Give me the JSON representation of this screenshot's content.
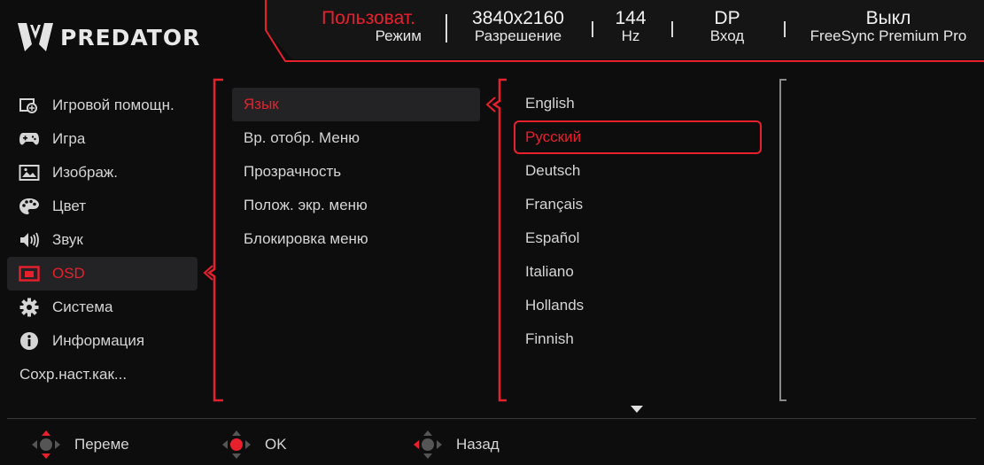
{
  "brand": {
    "logo_text": "PREDATOR"
  },
  "header": {
    "mode": {
      "value": "Пользоват.",
      "label": "Режим"
    },
    "resolution": {
      "value": "3840x2160",
      "label": "Разрешение"
    },
    "refresh": {
      "value": "144",
      "label": "Hz"
    },
    "input": {
      "value": "DP",
      "label": "Вход"
    },
    "freesync": {
      "value": "Выкл",
      "label": "FreeSync Premium Pro"
    }
  },
  "main_menu": {
    "selected": "OSD",
    "items": [
      {
        "label": "Игровой помощн.",
        "icon": "game-assist-icon"
      },
      {
        "label": "Игра",
        "icon": "gamepad-icon"
      },
      {
        "label": "Изображ.",
        "icon": "picture-icon"
      },
      {
        "label": "Цвет",
        "icon": "palette-icon"
      },
      {
        "label": "Звук",
        "icon": "speaker-icon"
      },
      {
        "label": "OSD",
        "icon": "osd-icon"
      },
      {
        "label": "Система",
        "icon": "gear-icon"
      },
      {
        "label": "Информация",
        "icon": "info-icon"
      },
      {
        "label": "Сохр.наст.как..."
      }
    ]
  },
  "osd_menu": {
    "selected": "Язык",
    "items": [
      {
        "label": "Язык"
      },
      {
        "label": "Вр. отобр. Меню"
      },
      {
        "label": "Прозрачность"
      },
      {
        "label": "Полож. экр. меню"
      },
      {
        "label": "Блокировка меню"
      }
    ]
  },
  "language_menu": {
    "selected": "Русский",
    "items": [
      {
        "label": "English"
      },
      {
        "label": "Русский"
      },
      {
        "label": "Deutsch"
      },
      {
        "label": "Français"
      },
      {
        "label": "Español"
      },
      {
        "label": "Italiano"
      },
      {
        "label": "Hollands"
      },
      {
        "label": "Finnish"
      }
    ]
  },
  "footer": {
    "move": {
      "label": "Переме"
    },
    "ok": {
      "label": "OK"
    },
    "back": {
      "label": "Назад"
    }
  },
  "colors": {
    "accent": "#e8202c",
    "background": "#0d0d0e",
    "text": "#d5d5d5",
    "selected_bg": "#232325"
  }
}
